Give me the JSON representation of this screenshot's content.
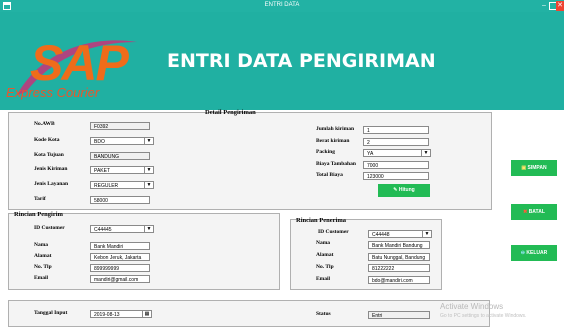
{
  "window": {
    "title": "ENTRI DATA",
    "minimize": "–",
    "close": "✕"
  },
  "header": {
    "logo": "SAP",
    "logo_sub": "Express Courier",
    "title": "ENTRI DATA PENGIRIMAN"
  },
  "detail": {
    "heading": "Detail Pengiriman",
    "no_awb": {
      "label": "No.AWB",
      "value": "F0392"
    },
    "kode_kota": {
      "label": "Kode Kota",
      "value": "BDO"
    },
    "kota_tujuan": {
      "label": "Kota Tujuan",
      "value": "BANDUNG"
    },
    "jenis_kiriman": {
      "label": "Jenis Kiriman",
      "value": "PAKET"
    },
    "jenis_layanan": {
      "label": "Jenis Layanan",
      "value": "REGULER"
    },
    "tarif": {
      "label": "Tarif",
      "value": "58000"
    },
    "jumlah_kiriman": {
      "label": "Jumlah kiriman",
      "value": "1"
    },
    "berat_kiriman": {
      "label": "Berat kiriman",
      "value": "2"
    },
    "packing": {
      "label": "Packing",
      "value": "YA"
    },
    "biaya_tambahan": {
      "label": "Biaya Tambahan",
      "value": "7000"
    },
    "total_biaya": {
      "label": "Total Biaya",
      "value": "123000"
    },
    "hitung_button": "Hitung"
  },
  "pengirim": {
    "heading": "Rincian Pengirim",
    "id_customer": {
      "label": "ID Customer",
      "value": "C44445"
    },
    "nama": {
      "label": "Nama",
      "value": "Bank Mandiri"
    },
    "alamat": {
      "label": "Alamat",
      "value": "Kebon Jeruk, Jakarta"
    },
    "no_tlp": {
      "label": "No. Tlp",
      "value": "899999999"
    },
    "email": {
      "label": "Email",
      "value": "mandiri@gmail.com"
    }
  },
  "penerima": {
    "heading": "Rincian Penerima",
    "id_customer": {
      "label": "ID Customer",
      "value": "C44448"
    },
    "nama": {
      "label": "Nama",
      "value": "Bank Mandiri Bandung"
    },
    "alamat": {
      "label": "Alamat",
      "value": "Batu Nunggal, Bandung"
    },
    "no_tlp": {
      "label": "No. Tlp",
      "value": "81222222"
    },
    "email": {
      "label": "Email",
      "value": "bdo@mandiri.com"
    }
  },
  "footer": {
    "tanggal": {
      "label": "Tanggal Input",
      "value": "2019-08-13"
    },
    "status": {
      "label": "Status",
      "value": "Entri"
    }
  },
  "actions": {
    "simpan": "SIMPAN",
    "batal": "BATAL",
    "keluar": "KELUAR"
  },
  "watermark": {
    "line1": "Activate Windows",
    "line2": "Go to PC settings to activate Windows."
  },
  "colors": {
    "header": "#20b0a2",
    "logo": "#ef6c1a",
    "button": "#22bb55"
  },
  "icons": [
    "app-icon",
    "dropdown-arrow-icon",
    "pencil-icon",
    "calendar-icon",
    "save-icon",
    "cancel-icon",
    "exit-icon"
  ]
}
